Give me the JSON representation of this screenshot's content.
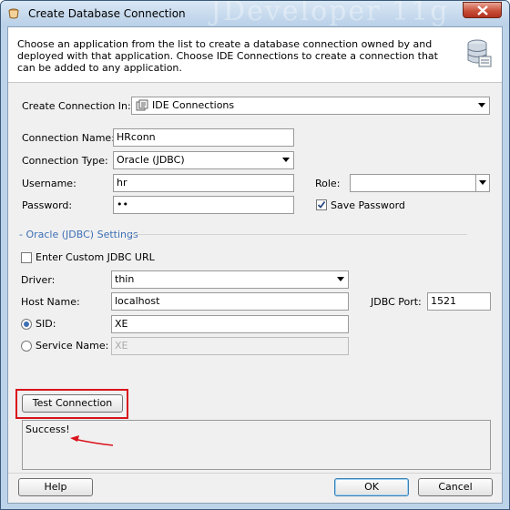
{
  "window": {
    "title": "Create Database Connection",
    "watermark": "JDeveloper 11g"
  },
  "header": {
    "description": "Choose an application from the list to create a database connection owned by and deployed with that application. Choose IDE Connections to create a connection that can be added to any application."
  },
  "form": {
    "create_in_label": "Create Connection In:",
    "create_in_value": "IDE Connections",
    "connection_name_label": "Connection Name:",
    "connection_name_value": "HRconn",
    "connection_type_label": "Connection Type:",
    "connection_type_value": "Oracle (JDBC)",
    "username_label": "Username:",
    "username_value": "hr",
    "password_label": "Password:",
    "password_value": "••",
    "role_label": "Role:",
    "role_value": "",
    "save_password_label": "Save Password",
    "save_password_checked": true
  },
  "oracle_settings": {
    "section_title": "- Oracle (JDBC) Settings",
    "custom_url_label": "Enter Custom JDBC URL",
    "driver_label": "Driver:",
    "driver_value": "thin",
    "host_label": "Host Name:",
    "host_value": "localhost",
    "port_label": "JDBC Port:",
    "port_value": "1521",
    "sid_label": "SID:",
    "sid_value": "XE",
    "service_label": "Service Name:",
    "service_value": "XE"
  },
  "test": {
    "button_label": "Test Connection",
    "result_text": "Success!"
  },
  "footer": {
    "help_label": "Help",
    "ok_label": "OK",
    "cancel_label": "Cancel"
  },
  "colors": {
    "highlight": "#d9141b",
    "accent": "#3d6fb5"
  }
}
